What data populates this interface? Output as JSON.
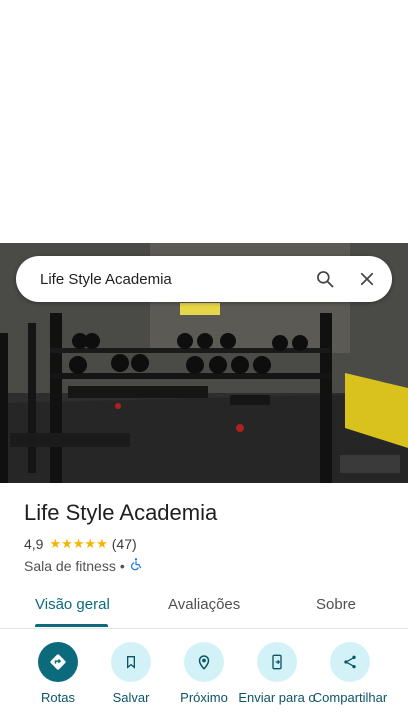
{
  "search": {
    "query": "Life Style Academia"
  },
  "place": {
    "name": "Life Style Academia",
    "rating": "4,9",
    "stars": "★★★★★",
    "review_count": "(47)",
    "category": "Sala de fitness",
    "separator": "•"
  },
  "tabs": [
    {
      "label": "Visão geral",
      "active": true
    },
    {
      "label": "Avaliações",
      "active": false
    },
    {
      "label": "Sobre",
      "active": false
    }
  ],
  "actions": [
    {
      "label": "Rotas",
      "icon": "directions-icon"
    },
    {
      "label": "Salvar",
      "icon": "bookmark-icon"
    },
    {
      "label": "Próximo",
      "icon": "nearby-icon"
    },
    {
      "label": "Enviar para o",
      "icon": "send-to-phone-icon"
    },
    {
      "label": "Compartilhar",
      "icon": "share-icon"
    }
  ],
  "colors": {
    "accent": "#0b6b7d",
    "action_bg": "#d3f2f8",
    "star": "#f4b400"
  }
}
